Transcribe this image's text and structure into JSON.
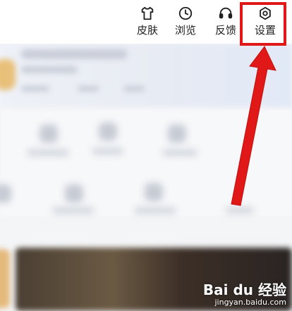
{
  "toolbar": {
    "items": [
      {
        "label": "皮肤",
        "icon": "shirt-icon"
      },
      {
        "label": "浏览",
        "icon": "clock-icon"
      },
      {
        "label": "反馈",
        "icon": "headset-icon"
      },
      {
        "label": "设置",
        "icon": "hexagon-settings-icon"
      }
    ]
  },
  "annotation": {
    "highlight_color": "#e01818"
  },
  "watermark": {
    "brand": "Bai du 经验",
    "url": "jingyan.baidu.com"
  }
}
